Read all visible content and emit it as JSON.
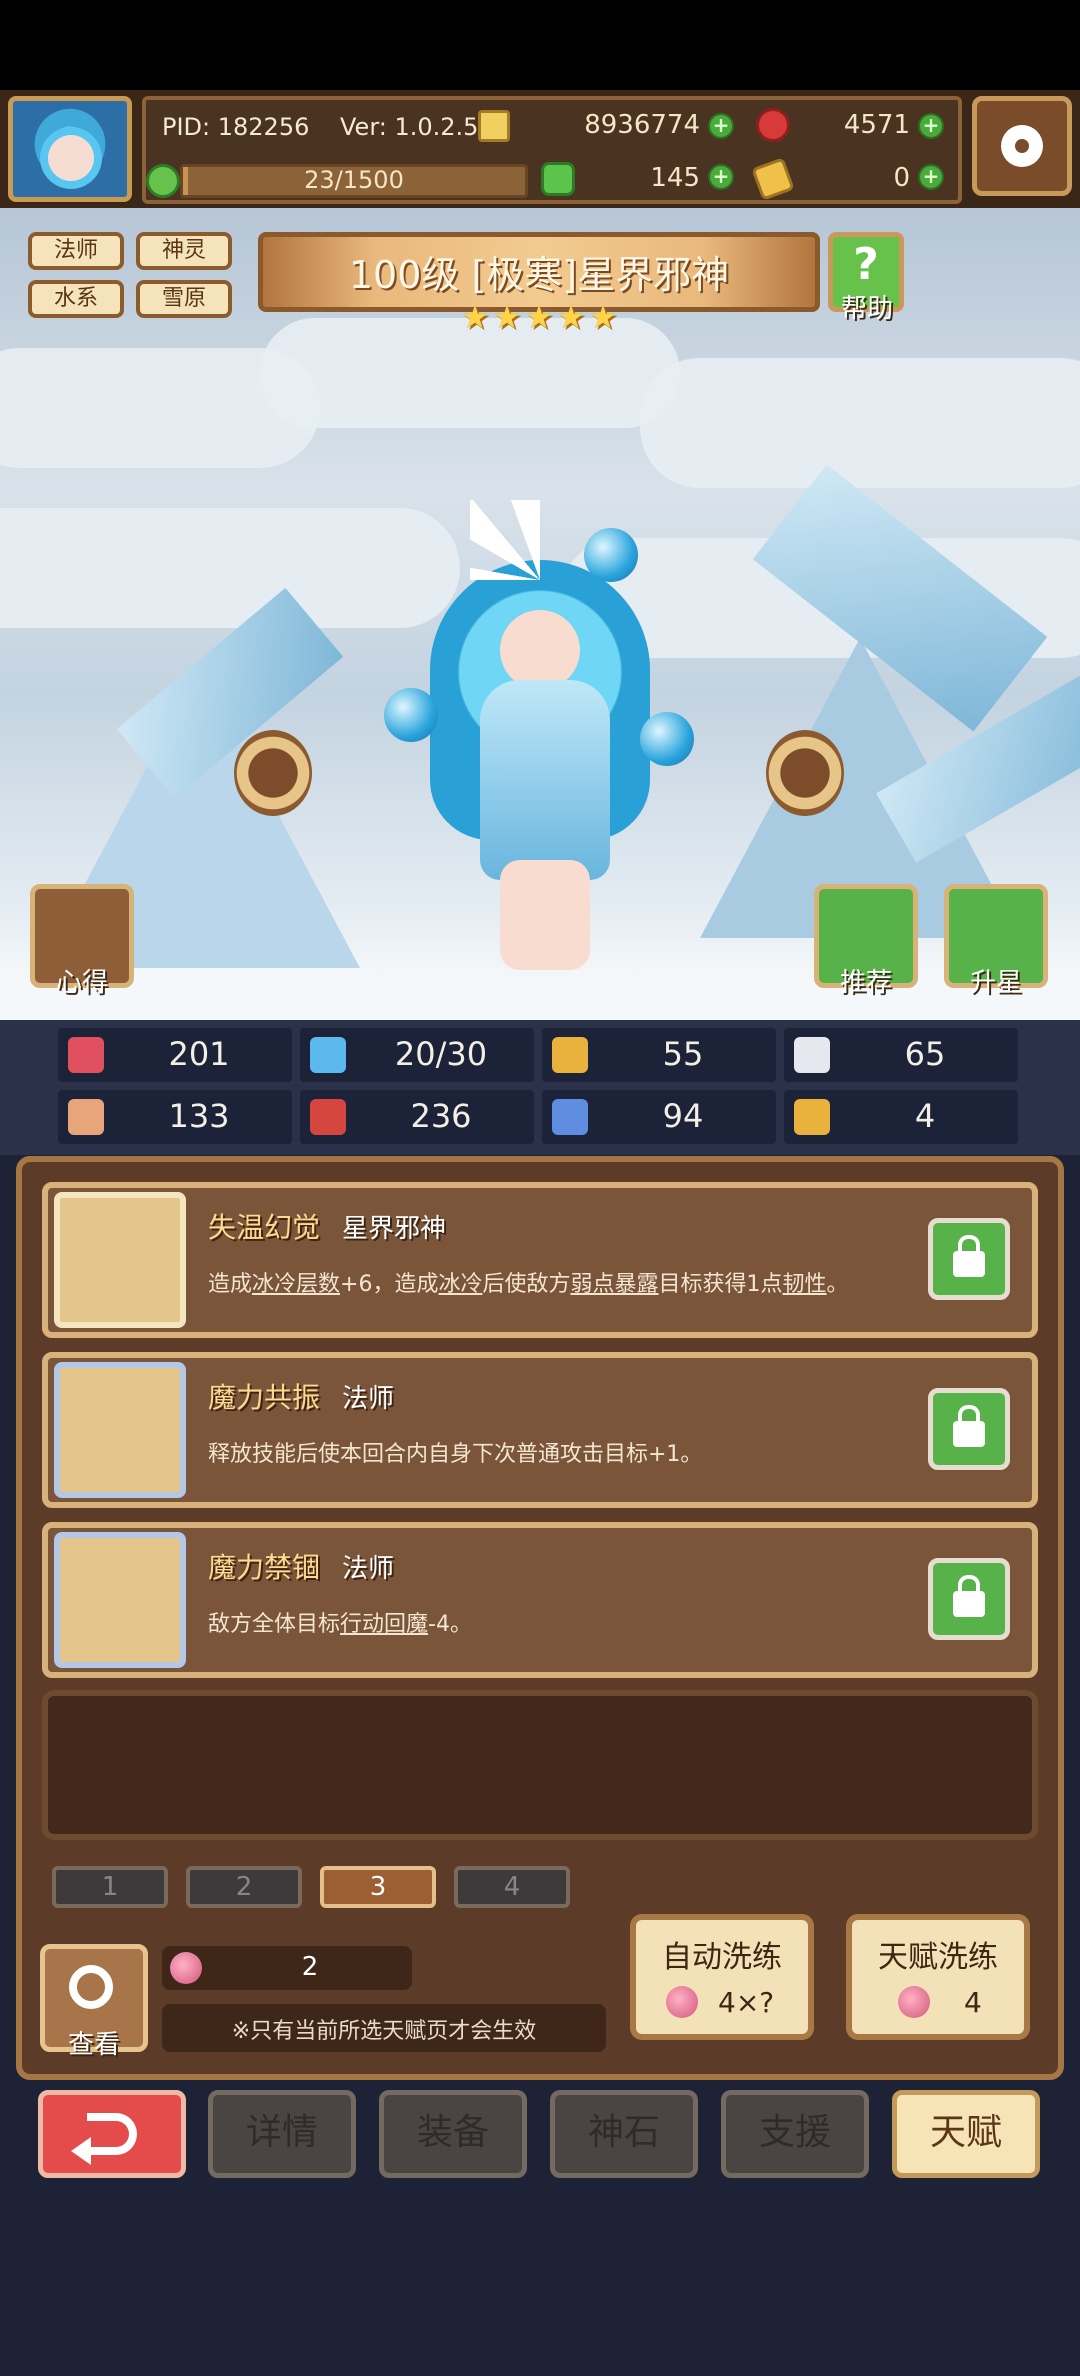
{
  "header": {
    "pid": "PID: 182256",
    "version": "Ver: 1.0.2.5",
    "gold": "8936774",
    "gems": "4571",
    "exp": "23/1500",
    "exp_progress": 0.015,
    "clover": "145",
    "keys": "0",
    "icons": {
      "gold": "coin-icon",
      "gems": "gem-icon",
      "exp": "exp-icon",
      "clover": "clover-icon",
      "keys": "key-icon",
      "settings": "gear-icon"
    }
  },
  "hero": {
    "tags": [
      "法师",
      "神灵",
      "水系",
      "雪原"
    ],
    "title": "100级 [极寒]星界邪神",
    "stars": 5,
    "help_label": "帮助"
  },
  "scene_buttons": {
    "insight": "心得",
    "recommend": "推荐",
    "star_up": "升星"
  },
  "stats": [
    {
      "icon": "heart-icon",
      "color": "#e0505e",
      "value": "201"
    },
    {
      "icon": "water-drop-icon",
      "color": "#5cb9f0",
      "value": "20/30"
    },
    {
      "icon": "shield-icon",
      "color": "#e8b23c",
      "value": "55"
    },
    {
      "icon": "wing-icon",
      "color": "#e7e7ef",
      "value": "65"
    },
    {
      "icon": "fist-icon",
      "color": "#e9a57a",
      "value": "133"
    },
    {
      "icon": "book-icon",
      "color": "#d4463f",
      "value": "236"
    },
    {
      "icon": "boot-icon",
      "color": "#5f8ee0",
      "value": "94"
    },
    {
      "icon": "horseshoe-icon",
      "color": "#e8b23c",
      "value": "4"
    }
  ],
  "talents": [
    {
      "name": "失温幻觉",
      "tag": "星界邪神",
      "desc_parts": [
        "造成",
        "冰冷层数",
        "+6，造成",
        "冰冷",
        "后使敌方",
        "弱点暴露",
        "目标获得1点",
        "韧性",
        "。"
      ],
      "icon": "star-icon"
    },
    {
      "name": "魔力共振",
      "tag": "法师",
      "desc_parts": [
        "释放技能后使本回合内自身下次普通攻击目标+1。"
      ],
      "icon": "staff-icon"
    },
    {
      "name": "魔力禁锢",
      "tag": "法师",
      "desc_parts": [
        "敌方全体目标",
        "行动回魔",
        "-4。"
      ],
      "icon": "staff-icon"
    }
  ],
  "pages": [
    "1",
    "2",
    "3",
    "4"
  ],
  "active_page": 2,
  "bottom": {
    "view_label": "查看",
    "fruit_count": "2",
    "note": "※只有当前所选天赋页才会生效",
    "auto_wash": {
      "title": "自动洗练",
      "cost": "4×?"
    },
    "talent_wash": {
      "title": "天赋洗练",
      "cost": "4"
    }
  },
  "nav": [
    "详情",
    "装备",
    "神石",
    "支援",
    "天赋"
  ],
  "nav_active": 4
}
